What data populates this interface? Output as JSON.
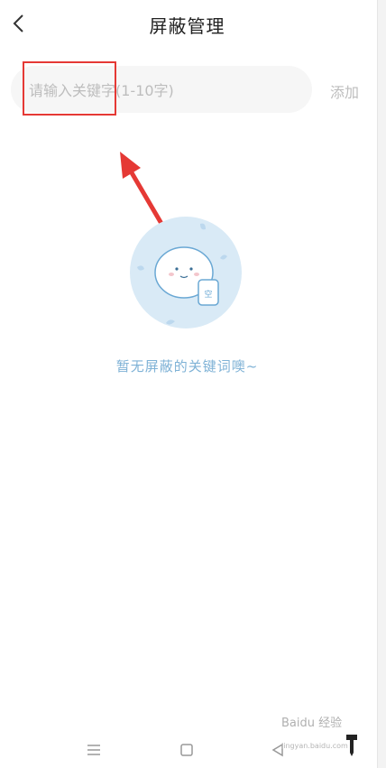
{
  "header": {
    "title": "屏蔽管理",
    "back_icon": "chevron-left-icon"
  },
  "search": {
    "placeholder": "请输入关键字(1-10字)",
    "value": "",
    "add_label": "添加"
  },
  "empty_state": {
    "illustration": "empty-box-mascot-icon",
    "message": "暂无屏蔽的关键词噢~"
  },
  "annotation": {
    "highlight_color": "#e53935",
    "arrow_color": "#e53935"
  },
  "navbar": {
    "menu_icon": "menu-icon",
    "home_icon": "home-square-icon",
    "back_icon": "triangle-back-icon"
  },
  "watermark": {
    "brand": "Baidu 经验",
    "url": "jingyan.baidu.com"
  },
  "colors": {
    "accent_text": "#7fb2d6",
    "placeholder": "#bdbdbd",
    "illustration_bg": "#d9eaf6"
  }
}
